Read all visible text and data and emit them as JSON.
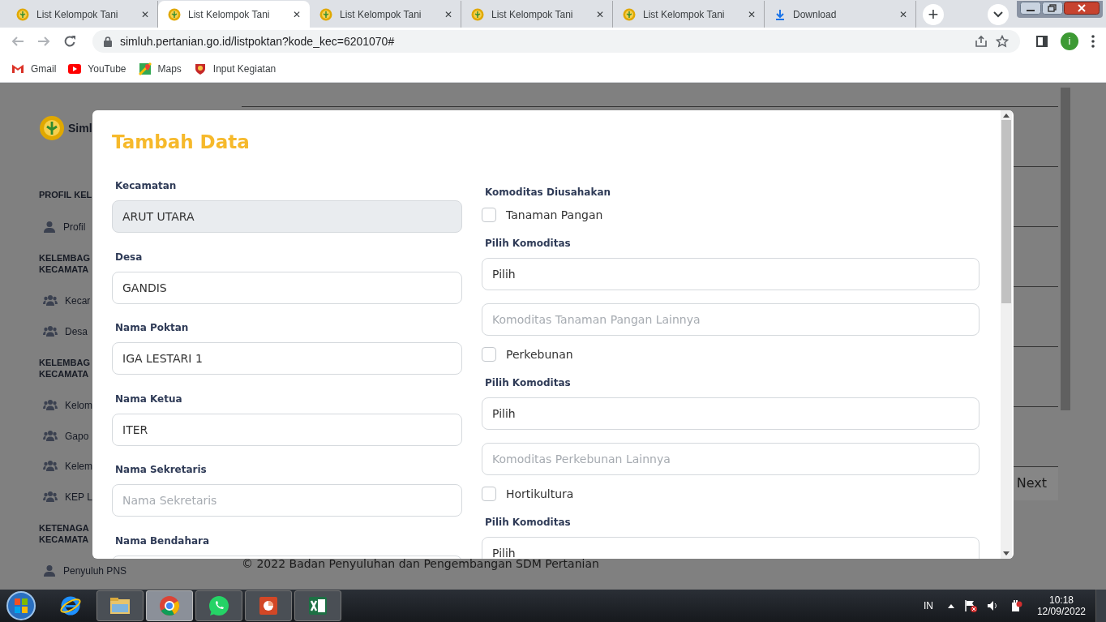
{
  "browser": {
    "tabs": [
      {
        "title": "List Kelompok Tani",
        "kind": "page",
        "selected": false
      },
      {
        "title": "List Kelompok Tani",
        "kind": "page",
        "selected": true
      },
      {
        "title": "List Kelompok Tani",
        "kind": "page",
        "selected": false
      },
      {
        "title": "List Kelompok Tani",
        "kind": "page",
        "selected": false
      },
      {
        "title": "List Kelompok Tani",
        "kind": "page",
        "selected": false
      },
      {
        "title": "Download",
        "kind": "download",
        "selected": false
      }
    ],
    "close_glyph": "✕",
    "new_tab_glyph": "+",
    "address": "simluh.pertanian.go.id/listpoktan?kode_kec=6201070#",
    "profile_initial": "i",
    "bookmarks": [
      {
        "label": "Gmail",
        "kind": "gmail"
      },
      {
        "label": "YouTube",
        "kind": "youtube"
      },
      {
        "label": "Maps",
        "kind": "maps"
      },
      {
        "label": "Input Kegiatan",
        "kind": "emblem"
      }
    ]
  },
  "background": {
    "brand": "Siml",
    "sidebar": [
      {
        "kind": "header",
        "label": "PROFIL KEL"
      },
      {
        "kind": "person",
        "label": "Profil"
      },
      {
        "kind": "header",
        "label": "KELEMBAG\nKECAMATA"
      },
      {
        "kind": "group",
        "label": "Kecar"
      },
      {
        "kind": "group",
        "label": "Desa"
      },
      {
        "kind": "header",
        "label": "KELEMBAG\nKECAMATA"
      },
      {
        "kind": "group",
        "label": "Kelom"
      },
      {
        "kind": "group",
        "label": "Gapo"
      },
      {
        "kind": "group",
        "label": "Kelem"
      },
      {
        "kind": "group",
        "label": "KEP L"
      },
      {
        "kind": "header",
        "label": "KETENAGA\nKECAMATA"
      },
      {
        "kind": "person",
        "label": "Penyuluh PNS"
      }
    ],
    "next_button": "Next",
    "footer": "© 2022 Badan Penyuluhan dan Pengembangan SDM Pertanian"
  },
  "modal": {
    "title": "Tambah Data",
    "left_fields": [
      {
        "label": "Kecamatan",
        "value": "ARUT UTARA",
        "disabled": true
      },
      {
        "label": "Desa",
        "value": "GANDIS",
        "disabled": false
      },
      {
        "label": "Nama Poktan",
        "value": "IGA LESTARI 1",
        "disabled": false
      },
      {
        "label": "Nama Ketua",
        "value": "ITER",
        "disabled": false
      },
      {
        "label": "Nama Sekretaris",
        "placeholder": "Nama Sekretaris",
        "disabled": false
      },
      {
        "label": "Nama Bendahara",
        "disabled": false
      }
    ],
    "right_items": [
      {
        "kind": "label",
        "label": "Komoditas Diusahakan"
      },
      {
        "kind": "checkbox",
        "label": "Tanaman Pangan",
        "checked": false
      },
      {
        "kind": "label",
        "label": "Pilih Komoditas"
      },
      {
        "kind": "select",
        "value": "Pilih"
      },
      {
        "kind": "input",
        "placeholder": "Komoditas Tanaman Pangan Lainnya"
      },
      {
        "kind": "checkbox",
        "label": "Perkebunan",
        "checked": false
      },
      {
        "kind": "label",
        "label": "Pilih Komoditas"
      },
      {
        "kind": "select",
        "value": "Pilih"
      },
      {
        "kind": "input",
        "placeholder": "Komoditas Perkebunan Lainnya"
      },
      {
        "kind": "checkbox",
        "label": "Hortikultura",
        "checked": false
      },
      {
        "kind": "label",
        "label": "Pilih Komoditas"
      },
      {
        "kind": "select",
        "value": "Pilih"
      }
    ]
  },
  "taskbar": {
    "apps": [
      {
        "kind": "ie",
        "selected": false
      },
      {
        "kind": "explorer",
        "selected": false
      },
      {
        "kind": "chrome",
        "selected": true
      },
      {
        "kind": "whatsapp",
        "selected": false
      },
      {
        "kind": "powerpoint",
        "selected": false
      },
      {
        "kind": "excel",
        "selected": false
      }
    ],
    "language": "IN",
    "time": "10:18",
    "date": "12/09/2022"
  }
}
